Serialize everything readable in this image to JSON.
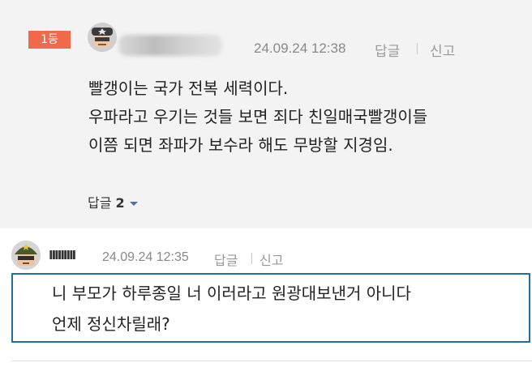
{
  "comment": {
    "rank_badge": "1등",
    "date": "24.09.24 12:38",
    "reply_label": "답글",
    "report_label": "신고",
    "separator": "|",
    "lines": [
      "빨갱이는 국가 전복 세력이다.",
      "우파라고 우기는 것들 보면 죄다 친일매국빨갱이들",
      "이쯤 되면 좌파가 보수라 해도 무방할 지경임."
    ],
    "reply_toggle": {
      "label": "답글",
      "count": "2"
    }
  },
  "reply": {
    "nickname": "IIIIIIIII",
    "date": "24.09.24 12:35",
    "reply_label": "답글",
    "report_label": "신고",
    "separator": "|",
    "lines": [
      "니 부모가 하루종일 너 이러라고 원광대보낸거 아니다",
      "언제 정신차릴래?"
    ]
  },
  "colors": {
    "badge": "#f06a4a",
    "highlight_border": "#1f6ea5",
    "comment_bg": "#f3f3f3"
  },
  "icons": {
    "avatar_1": "soldier-avatar-icon",
    "avatar_2": "army-helmet-avatar-icon",
    "toggle": "caret-down-icon"
  }
}
